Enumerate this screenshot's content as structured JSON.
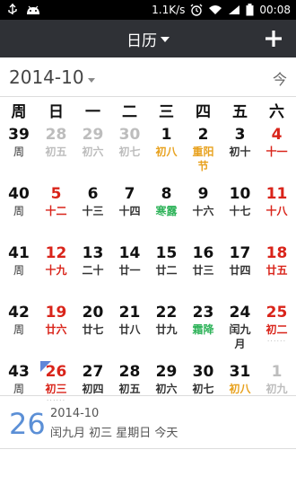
{
  "status_bar": {
    "speed": "1.1K/s",
    "time": "00:08",
    "icons": [
      "usb-icon",
      "android-icon",
      "alarm-icon",
      "wifi-icon",
      "signal-icon",
      "battery-icon"
    ]
  },
  "title_bar": {
    "title": "日历",
    "add_label": "+"
  },
  "month_header": {
    "label": "2014-10",
    "today_label": "今"
  },
  "weekday_header": [
    "周",
    "日",
    "一",
    "二",
    "三",
    "四",
    "五",
    "六"
  ],
  "weeks": [
    {
      "week_num": "39",
      "week_label": "周",
      "days": [
        {
          "day": "28",
          "lunar": "初五",
          "style": "muted"
        },
        {
          "day": "29",
          "lunar": "初六",
          "style": "muted"
        },
        {
          "day": "30",
          "lunar": "初七",
          "style": "muted"
        },
        {
          "day": "1",
          "lunar": "初八",
          "style": "normal",
          "lunar_color": "orange"
        },
        {
          "day": "2",
          "lunar": "重阳节",
          "style": "normal",
          "lunar_color": "orange"
        },
        {
          "day": "3",
          "lunar": "初十",
          "style": "normal"
        },
        {
          "day": "4",
          "lunar": "十一",
          "style": "weekend"
        }
      ]
    },
    {
      "week_num": "40",
      "week_label": "周",
      "days": [
        {
          "day": "5",
          "lunar": "十二",
          "style": "weekend"
        },
        {
          "day": "6",
          "lunar": "十三",
          "style": "normal"
        },
        {
          "day": "7",
          "lunar": "十四",
          "style": "normal"
        },
        {
          "day": "8",
          "lunar": "寒露",
          "style": "normal",
          "lunar_color": "green"
        },
        {
          "day": "9",
          "lunar": "十六",
          "style": "normal"
        },
        {
          "day": "10",
          "lunar": "十七",
          "style": "normal"
        },
        {
          "day": "11",
          "lunar": "十八",
          "style": "weekend"
        }
      ]
    },
    {
      "week_num": "41",
      "week_label": "周",
      "days": [
        {
          "day": "12",
          "lunar": "十九",
          "style": "weekend"
        },
        {
          "day": "13",
          "lunar": "二十",
          "style": "normal"
        },
        {
          "day": "14",
          "lunar": "廿一",
          "style": "normal"
        },
        {
          "day": "15",
          "lunar": "廿二",
          "style": "normal"
        },
        {
          "day": "16",
          "lunar": "廿三",
          "style": "normal"
        },
        {
          "day": "17",
          "lunar": "廿四",
          "style": "normal"
        },
        {
          "day": "18",
          "lunar": "廿五",
          "style": "weekend"
        }
      ]
    },
    {
      "week_num": "42",
      "week_label": "周",
      "days": [
        {
          "day": "19",
          "lunar": "廿六",
          "style": "weekend"
        },
        {
          "day": "20",
          "lunar": "廿七",
          "style": "normal"
        },
        {
          "day": "21",
          "lunar": "廿八",
          "style": "normal"
        },
        {
          "day": "22",
          "lunar": "廿九",
          "style": "normal"
        },
        {
          "day": "23",
          "lunar": "霜降",
          "style": "normal",
          "lunar_color": "green"
        },
        {
          "day": "24",
          "lunar": "闰九月",
          "style": "normal"
        },
        {
          "day": "25",
          "lunar": "初二",
          "style": "weekend",
          "dots": "......"
        }
      ]
    },
    {
      "week_num": "43",
      "week_label": "周",
      "days": [
        {
          "day": "26",
          "lunar": "初三",
          "style": "weekend",
          "today": true,
          "dots": "......"
        },
        {
          "day": "27",
          "lunar": "初四",
          "style": "normal"
        },
        {
          "day": "28",
          "lunar": "初五",
          "style": "normal"
        },
        {
          "day": "29",
          "lunar": "初六",
          "style": "normal"
        },
        {
          "day": "30",
          "lunar": "初七",
          "style": "normal"
        },
        {
          "day": "31",
          "lunar": "初八",
          "style": "normal",
          "lunar_color": "orange"
        },
        {
          "day": "1",
          "lunar": "初九",
          "style": "muted"
        }
      ]
    }
  ],
  "footer": {
    "big_day": "26",
    "year_month": "2014-10",
    "info": "闰九月 初三  星期日  今天"
  },
  "colors": {
    "title_bar_bg": "#2f3136",
    "weekend_red": "#d9241a",
    "festival_orange": "#e8a21f",
    "solar_term_green": "#2fb35a",
    "today_blue": "#5b8fd6"
  }
}
